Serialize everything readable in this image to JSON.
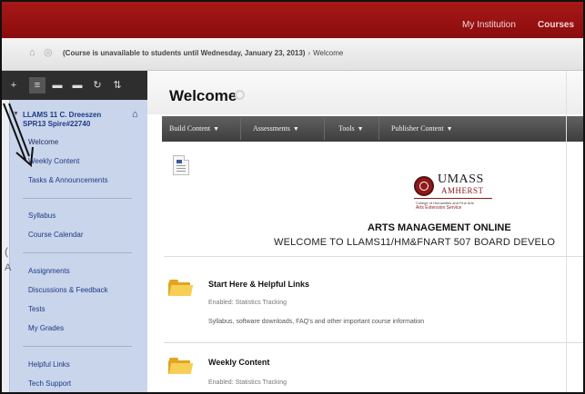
{
  "topbar": {
    "my_institution": "My Institution",
    "courses": "Courses"
  },
  "breadcrumb": {
    "notice": "(Course is unavailable to students until Wednesday, January 23, 2013)",
    "separator": "›",
    "current": "Welcome",
    "home_icon": "home-icon",
    "refresh_icon": "refresh-icon"
  },
  "sidebar": {
    "toolbar_icons": [
      "plus-icon",
      "list-view-icon",
      "folder-view-icon",
      "hide-icon",
      "refresh-icon",
      "sort-icon"
    ],
    "toolbar_glyphs": [
      "+",
      "≡",
      "▬",
      "▬",
      "↻",
      "⇅"
    ],
    "course_title": "LLAMS 11 C. Dreeszen SPR13 Spire#22740",
    "items": [
      {
        "label": "Welcome"
      },
      {
        "label": "Weekly Content"
      },
      {
        "label": "Tasks & Announcements"
      },
      {
        "label": "Syllabus"
      },
      {
        "label": "Course Calendar"
      },
      {
        "label": "Assignments"
      },
      {
        "label": "Discussions & Feedback"
      },
      {
        "label": "Tests"
      },
      {
        "label": "My Grades"
      },
      {
        "label": "Helpful Links"
      },
      {
        "label": "Tech Support"
      }
    ]
  },
  "main": {
    "title": "Welcome",
    "actions": [
      {
        "label": "Build Content"
      },
      {
        "label": "Assessments"
      },
      {
        "label": "Tools"
      },
      {
        "label": "Publisher Content"
      }
    ],
    "logo": {
      "name": "UMASS",
      "sub": "AMHERST",
      "line1": "College of Humanities and Fine Arts",
      "line2": "Arts Extension Service"
    },
    "headline": "ARTS MANAGEMENT ONLINE",
    "subline": "WELCOME TO LLAMS11/HM&FNART 507 BOARD DEVELO",
    "content_items": [
      {
        "title": "Start Here & Helpful Links",
        "meta": "Enabled:  Statistics Tracking",
        "description": "Syllabus, software downloads, FAQ's and other important course information"
      },
      {
        "title": "Weekly Content",
        "meta": "Enabled:  Statistics Tracking",
        "description": ""
      }
    ]
  },
  "colors": {
    "topbar": "#9b1212",
    "sidebar_menu": "#c9d5ea",
    "link": "#1d3a87",
    "action_bar": "#4a4a4a",
    "folder": "#f8cf56"
  }
}
